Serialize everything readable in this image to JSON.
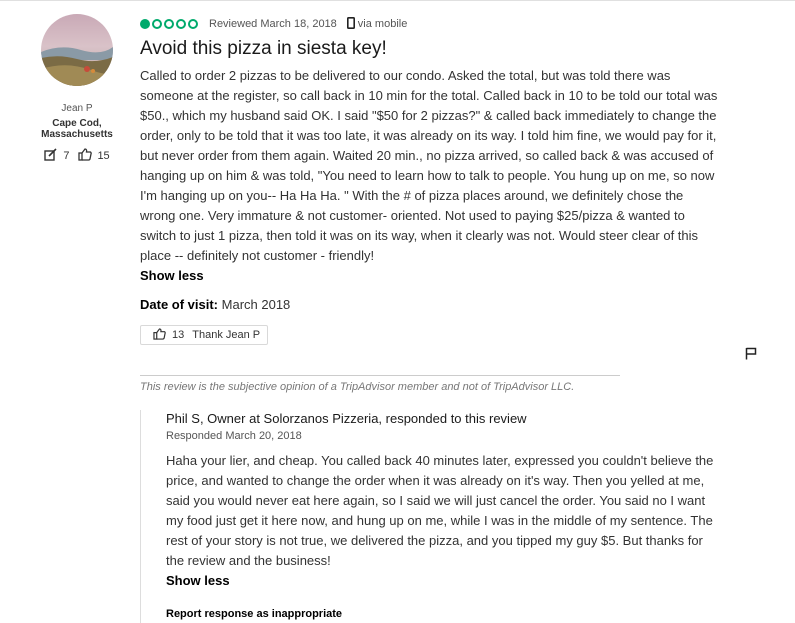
{
  "reviewer": {
    "name": "Jean P",
    "location": "Cape Cod, Massachusetts",
    "contributions": "7",
    "helpful_votes": "15"
  },
  "review": {
    "rating_bubbles": 1,
    "rating_max": 5,
    "reviewed_date": "Reviewed March 18, 2018",
    "via": "via mobile",
    "title": "Avoid this pizza in siesta key!",
    "body": "Called to order 2 pizzas to be delivered to our condo. Asked the total, but was told there was someone at the register, so call back in 10 min for the total. Called back in 10 to be told our total was $50., which my husband said OK. I said \"$50 for 2 pizzas?\" & called back immediately to change the order, only to be told that it was too late, it was already on its way. I told him fine, we would pay for it, but never order from them again. Waited 20 min., no pizza arrived, so called back & was accused of hanging up on him & was told, \"You need to learn how to talk to people. You hung up on me, so now I'm hanging up on you-- Ha Ha Ha. \" With the # of pizza places around, we definitely chose the wrong one. Very immature & not customer- oriented. Not used to paying $25/pizza & wanted to switch to just 1 pizza, then told it was on its way, when it clearly was not. Would steer clear of this place -- definitely not customer - friendly!",
    "show_less": "Show less",
    "date_of_visit_label": "Date of visit:",
    "date_of_visit": "March 2018",
    "thank_count": "13",
    "thank_label": "Thank Jean P",
    "disclaimer": "This review is the subjective opinion of a TripAdvisor member and not of TripAdvisor LLC."
  },
  "response": {
    "header": "Phil S, Owner at Solorzanos Pizzeria, responded to this review",
    "date": "Responded March 20, 2018",
    "body": "Haha your lier, and cheap. You called back 40 minutes later, expressed you couldn't believe the price, and wanted to change the order when it was already on it's way. Then you yelled at me, said you would never eat here again, so I said we will just cancel the order. You said no I want my food just get it here now, and hung up on me, while I was in the middle of my sentence. The rest of your story is not true, we delivered the pizza, and you tipped my guy $5. But thanks for the review and the business!",
    "show_less": "Show less",
    "report": "Report response as inappropriate"
  },
  "colors": {
    "bubble": "#00aa6c",
    "text": "#333333",
    "muted": "#555555"
  }
}
